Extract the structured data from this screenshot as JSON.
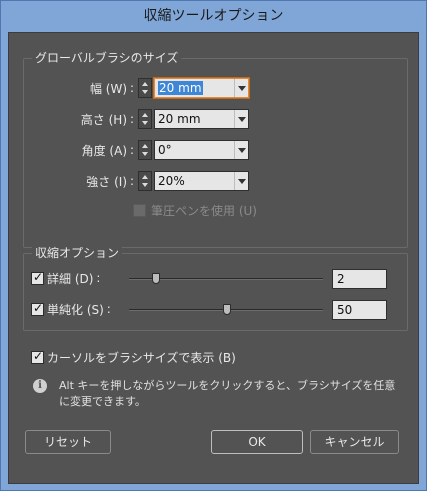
{
  "dialog": {
    "title": "収縮ツールオプション"
  },
  "global_brush": {
    "group_label": "グローバルブラシのサイズ",
    "width": {
      "label": "幅 (W)",
      "value": "20 mm"
    },
    "height": {
      "label": "高さ (H)",
      "value": "20 mm"
    },
    "angle": {
      "label": "角度 (A)",
      "value": "0°"
    },
    "intensity": {
      "label": "強さ (I)",
      "value": "20%"
    },
    "pressure_pen": {
      "label": "筆圧ペンを使用 (U)",
      "checked": false,
      "enabled": false
    }
  },
  "shrink_options": {
    "group_label": "収縮オプション",
    "detail": {
      "label": "詳細 (D)",
      "checked": true,
      "value": "2",
      "level": 0.2
    },
    "simplify": {
      "label": "単純化 (S)",
      "checked": true,
      "value": "50",
      "level": 0.5
    }
  },
  "cursor_option": {
    "label": "カーソルをブラシサイズで表示 (B)",
    "checked": true
  },
  "info": {
    "line1": "Alt キーを押しながらツールをクリックすると、ブラシサイズを任意",
    "line2": "に変更できます。"
  },
  "buttons": {
    "reset": "リセット",
    "ok": "OK",
    "cancel": "キャンセル"
  },
  "colors": {
    "panel": "#535353",
    "title_bar": "#7fa6d6",
    "focus": "#e08a3c",
    "selection": "#3e86d6"
  }
}
